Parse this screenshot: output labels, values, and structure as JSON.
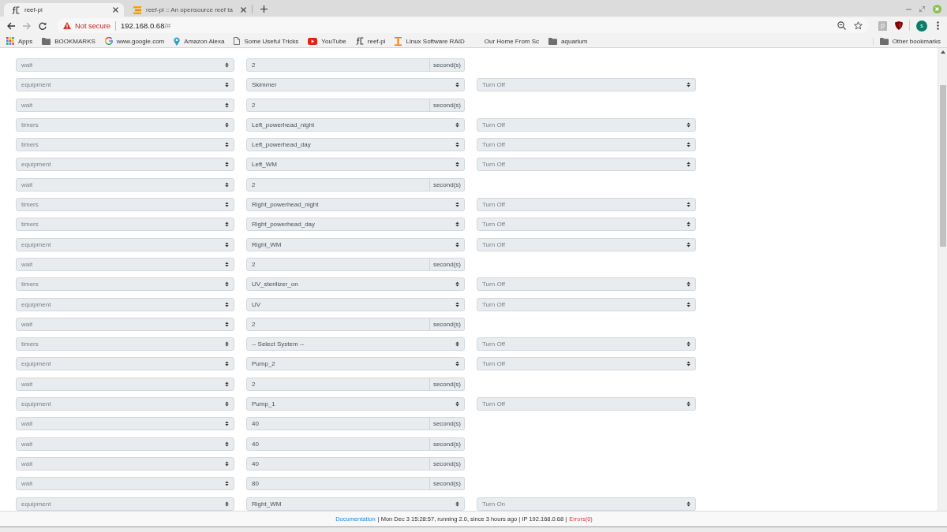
{
  "browser": {
    "tabs": [
      {
        "title": "reef-pi",
        "kind": "reefpi",
        "selected": true
      },
      {
        "title": "reef-pi :: An opensource reef ta",
        "kind": "stack",
        "selected": false
      }
    ],
    "nav_buttons": [
      {
        "kind": "back",
        "disabled": false
      },
      {
        "kind": "forward",
        "disabled": true
      },
      {
        "kind": "reload",
        "disabled": false
      }
    ],
    "security": "Not secure",
    "url": "192.168.0.68",
    "url_path": "/#",
    "extension_badge": "p",
    "profile_initial": "s"
  },
  "bookmarks": [
    {
      "label": "Apps",
      "kind": "apps"
    },
    {
      "label": "BOOKMARKS",
      "kind": "folder"
    },
    {
      "label": "www.google.com",
      "kind": "google"
    },
    {
      "label": "Amazon Alexa",
      "kind": "pin"
    },
    {
      "label": "Some Useful Tricks",
      "kind": "page"
    },
    {
      "label": "YouTube",
      "kind": "youtube"
    },
    {
      "label": "reef-pi",
      "kind": "reefpi"
    },
    {
      "label": "Linux Software RAID",
      "kind": "bars"
    },
    {
      "label": "Our Home From Sc",
      "kind": "blank"
    },
    {
      "label": "aquarium",
      "kind": "folder"
    }
  ],
  "other_bookmarks": "Other bookmarks",
  "steps": [
    {
      "kind": "wait",
      "type": "wait",
      "value": "2",
      "unit": "second(s)"
    },
    {
      "kind": "control",
      "type": "equipment",
      "target": "Skimmer",
      "action": "Turn Off"
    },
    {
      "kind": "wait",
      "type": "wait",
      "value": "2",
      "unit": "second(s)"
    },
    {
      "kind": "control",
      "type": "timers",
      "target": "Left_powerhead_night",
      "action": "Turn Off"
    },
    {
      "kind": "control",
      "type": "timers",
      "target": "Left_powerhead_day",
      "action": "Turn Off"
    },
    {
      "kind": "control",
      "type": "equipment",
      "target": "Left_WM",
      "action": "Turn Off"
    },
    {
      "kind": "wait",
      "type": "wait",
      "value": "2",
      "unit": "second(s)"
    },
    {
      "kind": "control",
      "type": "timers",
      "target": "Right_powerhead_night",
      "action": "Turn Off"
    },
    {
      "kind": "control",
      "type": "timers",
      "target": "Right_powerhead_day",
      "action": "Turn Off"
    },
    {
      "kind": "control",
      "type": "equipment",
      "target": "Right_WM",
      "action": "Turn Off"
    },
    {
      "kind": "wait",
      "type": "wait",
      "value": "2",
      "unit": "second(s)"
    },
    {
      "kind": "control",
      "type": "timers",
      "target": "UV_sterilizer_on",
      "action": "Turn Off"
    },
    {
      "kind": "control",
      "type": "equipment",
      "target": "UV",
      "action": "Turn Off"
    },
    {
      "kind": "wait",
      "type": "wait",
      "value": "2",
      "unit": "second(s)"
    },
    {
      "kind": "control",
      "type": "timers",
      "target": "-- Select System --",
      "action": "Turn Off"
    },
    {
      "kind": "control",
      "type": "equipment",
      "target": "Pump_2",
      "action": "Turn Off"
    },
    {
      "kind": "wait",
      "type": "wait",
      "value": "2",
      "unit": "second(s)"
    },
    {
      "kind": "control",
      "type": "equipment",
      "target": "Pump_1",
      "action": "Turn Off"
    },
    {
      "kind": "wait",
      "type": "wait",
      "value": "40",
      "unit": "second(s)"
    },
    {
      "kind": "wait",
      "type": "wait",
      "value": "40",
      "unit": "second(s)"
    },
    {
      "kind": "wait",
      "type": "wait",
      "value": "40",
      "unit": "second(s)"
    },
    {
      "kind": "wait",
      "type": "wait",
      "value": "80",
      "unit": "second(s)"
    },
    {
      "kind": "control",
      "type": "equipment",
      "target": "Right_WM",
      "action": "Turn On"
    }
  ],
  "footer": {
    "link": "Documentation",
    "status": "| Mon Dec 3 15:28:57, running 2.0, since 3 hours ago | IP 192.168.0.68 |",
    "errors": "Errors(0)"
  }
}
